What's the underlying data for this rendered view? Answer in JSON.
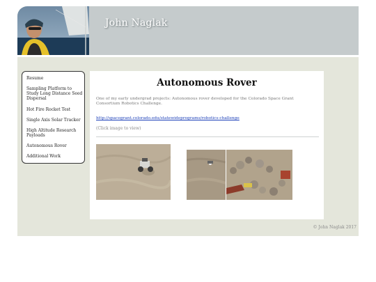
{
  "site": {
    "title": "John Naglak"
  },
  "sidebar": {
    "items": [
      {
        "label": "Resume"
      },
      {
        "label": "Sampling Platform to Study Long Distance Seed Dispersal"
      },
      {
        "label": "Hot Fire Rocket Test"
      },
      {
        "label": "Single Axis Solar Tracker"
      },
      {
        "label": "High Altitude Research Payloads"
      },
      {
        "label": "Autonomous Rover"
      },
      {
        "label": "Additional Work"
      }
    ]
  },
  "main": {
    "title": "Autonomous Rover",
    "description": "One of my early undergrad projects: Autonomous rover developed for the Colorado Space Grant Consortium Robotics Challenge.",
    "link": "http://spacegrant.colorado.edu/statewideprograms/robotics-challenge",
    "hint": "(Click image to view)"
  },
  "footer": {
    "copyright": "© John Naglak 2017"
  },
  "colors": {
    "frame": "#e4e6db",
    "header": "#c5cbcc",
    "link": "#1a3eb8",
    "sand": "#bcae98"
  },
  "icons": {
    "header_photo": "sailing-portrait-photo",
    "gallery": [
      "rover-on-sand-photo",
      "sand-field-photo",
      "rover-rock-course-photo"
    ]
  }
}
